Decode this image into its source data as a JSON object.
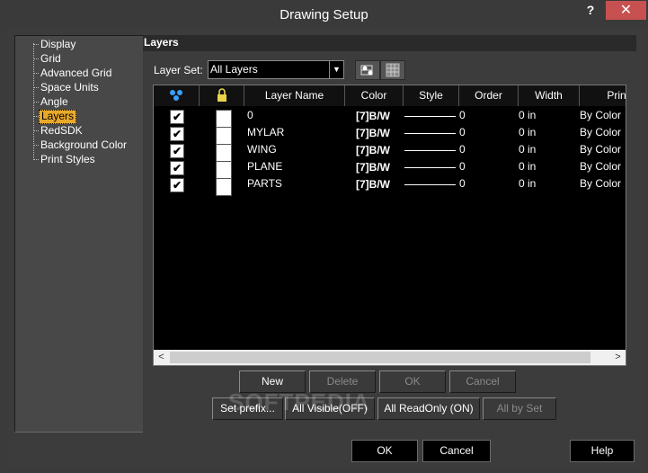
{
  "window": {
    "title": "Drawing Setup",
    "help_glyph": "?",
    "close_glyph": "✕"
  },
  "tree": {
    "items": [
      {
        "label": "Display"
      },
      {
        "label": "Grid"
      },
      {
        "label": "Advanced Grid"
      },
      {
        "label": "Space Units"
      },
      {
        "label": "Angle"
      },
      {
        "label": "Layers",
        "selected": true
      },
      {
        "label": "RedSDK"
      },
      {
        "label": "Background Color"
      },
      {
        "label": "Print Styles"
      }
    ]
  },
  "panel": {
    "title": "Layers",
    "layer_set_label": "Layer Set:",
    "layer_set_value": "All Layers",
    "tools": [
      "layer-tool-icon",
      "layer-grid-icon"
    ]
  },
  "grid": {
    "columns": [
      "",
      "",
      "Layer Name",
      "Color",
      "Style",
      "Order",
      "Width",
      "Print"
    ],
    "column_icons": [
      "visibility-icon",
      "lock-icon"
    ],
    "rows": [
      {
        "visible": true,
        "locked": false,
        "name": "0",
        "color": "[7]B/W",
        "order": "0",
        "width": "0 in",
        "print": "By Color"
      },
      {
        "visible": true,
        "locked": false,
        "name": "MYLAR",
        "color": "[7]B/W",
        "order": "0",
        "width": "0 in",
        "print": "By Color"
      },
      {
        "visible": true,
        "locked": false,
        "name": "WING",
        "color": "[7]B/W",
        "order": "0",
        "width": "0 in",
        "print": "By Color"
      },
      {
        "visible": true,
        "locked": false,
        "name": "PLANE",
        "color": "[7]B/W",
        "order": "0",
        "width": "0 in",
        "print": "By Color"
      },
      {
        "visible": true,
        "locked": false,
        "name": "PARTS",
        "color": "[7]B/W",
        "order": "0",
        "width": "0 in",
        "print": "By Color"
      }
    ],
    "check_glyph": "✔"
  },
  "buttons": {
    "new": "New",
    "delete": "Delete",
    "ok_inner": "OK",
    "cancel_inner": "Cancel",
    "set_prefix": "Set prefix...",
    "all_visible": "All Visible(OFF)",
    "all_readonly": "All ReadOnly (ON)",
    "all_by_set": "All by Set",
    "ok": "OK",
    "cancel": "Cancel",
    "help": "Help"
  },
  "watermark": "SOFTPEDIA",
  "colors": {
    "selection": "#e8a92b",
    "close": "#c75050"
  }
}
